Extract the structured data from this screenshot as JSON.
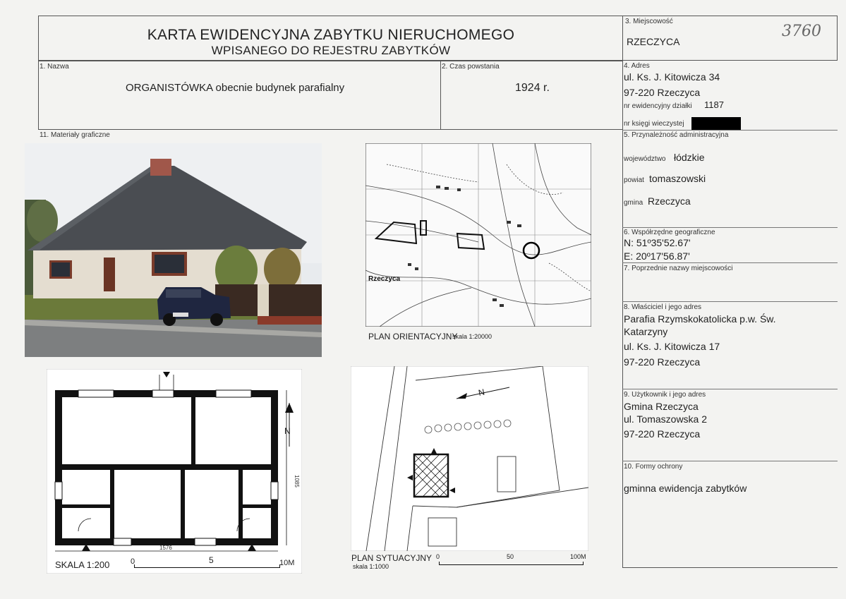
{
  "header": {
    "title_line1": "KARTA EWIDENCYJNA ZABYTKU NIERUCHOMEGO",
    "title_line2": "WPISANEGO DO REJESTRU ZABYTKÓW",
    "handwritten_number": "3760"
  },
  "fields": {
    "name": {
      "label": "1. Nazwa",
      "value": "ORGANISTÓWKA obecnie budynek parafialny"
    },
    "date": {
      "label": "2. Czas powstania",
      "value": "1924 r."
    },
    "place": {
      "label": "3. Miejscowość",
      "value": "RZECZYCA"
    },
    "address": {
      "label": "4. Adres",
      "line1": "ul. Ks. J. Kitowicza 34",
      "line2": "97-220 Rzeczyca",
      "parcel_label": "nr ewidencyjny działki",
      "parcel_value": "1187",
      "book_label": "nr księgi wieczystej"
    },
    "admin": {
      "label": "5. Przynależność administracyjna",
      "voivodeship_label": "województwo",
      "voivodeship": "łódzkie",
      "county_label": "powiat",
      "county": "tomaszowski",
      "commune_label": "gmina",
      "commune": "Rzeczyca"
    },
    "coords": {
      "label": "6. Współrzędne geograficzne",
      "n": "N: 51º35'52.67'",
      "e": "E: 20º17'56.87'"
    },
    "former_names": {
      "label": "7. Poprzednie nazwy miejscowości"
    },
    "owner": {
      "label": "8. Właściciel i jego adres",
      "line1": "Parafia Rzymskokatolicka p.w. Św.",
      "line2": "Katarzyny",
      "line3": "ul. Ks. J. Kitowicza 17",
      "line4": "97-220 Rzeczyca"
    },
    "user": {
      "label": "9. Użytkownik i jego adres",
      "line1": "Gmina Rzeczyca",
      "line2": "ul. Tomaszowska 2",
      "line3": "97-220 Rzeczyca"
    },
    "protection": {
      "label": "10. Formy ochrony",
      "value": "gminna ewidencja zabytków"
    },
    "graphics": {
      "label": "11. Materiały graficzne"
    }
  },
  "drawings": {
    "orientation_plan": {
      "caption": "PLAN ORIENTACYJNY",
      "scale": "skala 1:20000",
      "map_label": "Rzeczyca"
    },
    "floor_plan": {
      "scale_label": "SKALA 1:200",
      "tick0": "0",
      "tick5": "5",
      "tick10": "10M",
      "dim_width": "1576",
      "dim_height": "1085"
    },
    "site_plan": {
      "caption": "PLAN SYTUACYJNY",
      "scale": "skala 1:1000",
      "tick0": "0",
      "tick50": "50",
      "tick100": "100M"
    }
  }
}
